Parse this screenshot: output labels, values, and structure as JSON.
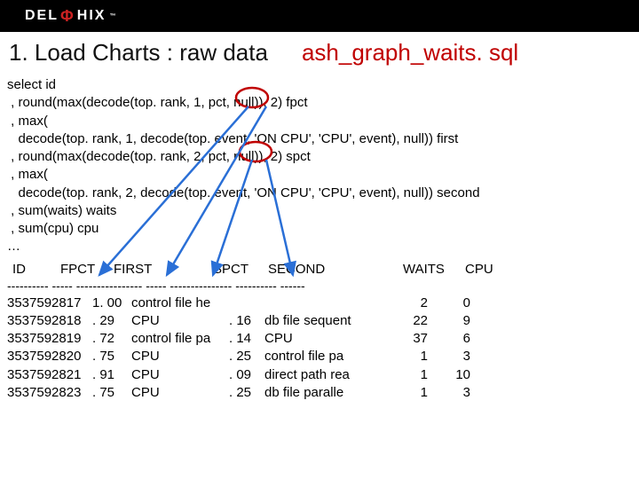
{
  "logo": {
    "left": "DEL",
    "mid": "Φ",
    "right": "HIX",
    "tm": "™"
  },
  "title": {
    "left": "1. Load Charts : raw data",
    "right": "ash_graph_waits. sql"
  },
  "sql": {
    "l0": "select id",
    "l1": " , round(max(decode(top. rank, 1, pct, null)), 2) fpct",
    "l2": " , max(",
    "l3": "   decode(top. rank, 1, decode(top. event, 'ON CPU', 'CPU', event), null)) first",
    "l4": " , round(max(decode(top. rank, 2, pct, null)), 2) spct",
    "l5": " , max(",
    "l6": "   decode(top. rank, 2, decode(top. event, 'ON CPU', 'CPU', event), null)) second",
    "l7": " , sum(waits) waits",
    "l8": " , sum(cpu) cpu",
    "l9": "…"
  },
  "columns": {
    "id": "ID",
    "fpct": "FPCT",
    "first": "FIRST",
    "spct": "SPCT",
    "second": "SECOND",
    "waits": "WAITS",
    "cpu": "CPU"
  },
  "dashes": "---------- ----- ---------------- ----- --------------- ---------- ------",
  "rows": [
    {
      "id": "3537592817",
      "fpct": "1. 00",
      "first": "control file he",
      "spct": "",
      "second": "",
      "waits": "2",
      "cpu": "0"
    },
    {
      "id": "3537592818",
      "fpct": ". 29",
      "first": "CPU",
      "spct": ". 16",
      "second": "db file sequent",
      "waits": "22",
      "cpu": "9"
    },
    {
      "id": "3537592819",
      "fpct": ". 72",
      "first": "control file pa",
      "spct": ". 14",
      "second": "CPU",
      "waits": "37",
      "cpu": "6"
    },
    {
      "id": "3537592820",
      "fpct": ". 75",
      "first": "CPU",
      "spct": ". 25",
      "second": "control file pa",
      "waits": "1",
      "cpu": "3"
    },
    {
      "id": "3537592821",
      "fpct": ". 91",
      "first": "CPU",
      "spct": ". 09",
      "second": "direct path rea",
      "waits": "1",
      "cpu": "10"
    },
    {
      "id": "3537592823",
      "fpct": ". 75",
      "first": "CPU",
      "spct": ". 25",
      "second": "db file paralle",
      "waits": "1",
      "cpu": "3"
    }
  ]
}
